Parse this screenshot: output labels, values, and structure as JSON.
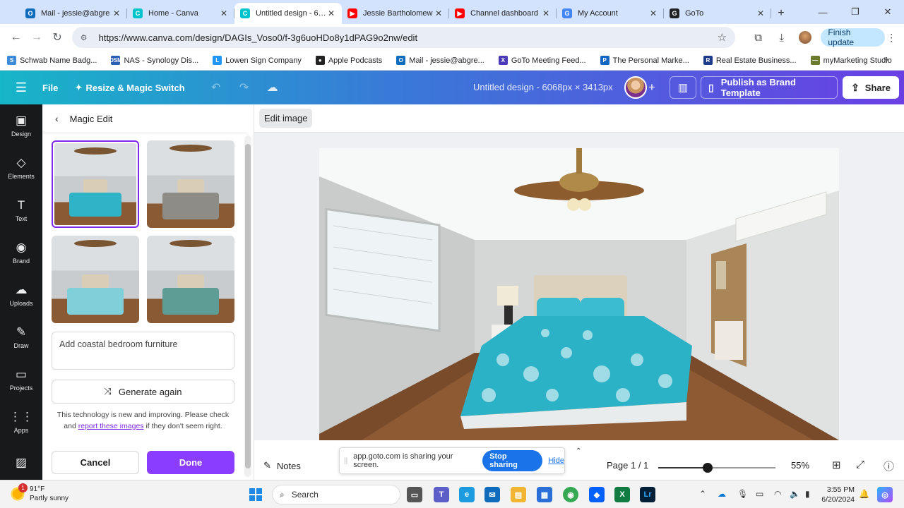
{
  "browser": {
    "tabs": [
      {
        "title": "Mail - jessie@abgre",
        "favicon": "outlook-icon",
        "color": "#0f6cbd",
        "glyph": "O"
      },
      {
        "title": "Home - Canva",
        "favicon": "canva-icon",
        "color": "#00c4cc",
        "glyph": "C"
      },
      {
        "title": "Untitled design - 606",
        "favicon": "canva-icon",
        "color": "#00c4cc",
        "glyph": "C",
        "active": true
      },
      {
        "title": "Jessie Bartholomew",
        "favicon": "youtube-icon",
        "color": "#ff0000",
        "glyph": "▶"
      },
      {
        "title": "Channel dashboard",
        "favicon": "youtube-icon",
        "color": "#ff0000",
        "glyph": "▶"
      },
      {
        "title": "My Account",
        "favicon": "google-icon",
        "color": "#4285f4",
        "glyph": "G"
      },
      {
        "title": "GoTo",
        "favicon": "goto-icon",
        "color": "#202124",
        "glyph": "G"
      }
    ],
    "url": "https://www.canva.com/design/DAGIs_Voso0/f-3g6uoHDo8y1dPAG9o2nw/edit",
    "finish_update": "Finish update",
    "bookmarks": [
      {
        "label": "Schwab Name Badg...",
        "color": "#3d8bd9",
        "glyph": "S"
      },
      {
        "label": "NAS - Synology Dis...",
        "color": "#2b5fb3",
        "glyph": "DSM"
      },
      {
        "label": "Lowen Sign Company",
        "color": "#2196f3",
        "glyph": "L"
      },
      {
        "label": "Apple Podcasts",
        "color": "#222222",
        "glyph": "●"
      },
      {
        "label": "Mail - jessie@abgre...",
        "color": "#0f6cbd",
        "glyph": "O"
      },
      {
        "label": "GoTo Meeting Feed...",
        "color": "#4a3ab8",
        "glyph": "X"
      },
      {
        "label": "The Personal Marke...",
        "color": "#1565c0",
        "glyph": "P"
      },
      {
        "label": "Real Estate Business...",
        "color": "#1e3a8a",
        "glyph": "R"
      },
      {
        "label": "myMarketing Studio",
        "color": "#6b7a2c",
        "glyph": "—"
      }
    ]
  },
  "canva": {
    "file": "File",
    "resize": "Resize & Magic Switch",
    "design_title": "Untitled design - 6068px × 3413px",
    "publish": "Publish as Brand Template",
    "share": "Share",
    "rail": [
      {
        "label": "Design",
        "icon": "design-icon",
        "glyph": "▣"
      },
      {
        "label": "Elements",
        "icon": "elements-icon",
        "glyph": "◇"
      },
      {
        "label": "Text",
        "icon": "text-icon",
        "glyph": "T"
      },
      {
        "label": "Brand",
        "icon": "brand-icon",
        "glyph": "◉"
      },
      {
        "label": "Uploads",
        "icon": "uploads-icon",
        "glyph": "☁"
      },
      {
        "label": "Draw",
        "icon": "draw-icon",
        "glyph": "✎"
      },
      {
        "label": "Projects",
        "icon": "projects-icon",
        "glyph": "▭"
      },
      {
        "label": "Apps",
        "icon": "apps-icon",
        "glyph": "⋮⋮"
      }
    ],
    "panel": {
      "title": "Magic Edit",
      "prompt": "Add coastal bedroom furniture",
      "generate": "Generate again",
      "note_part1": "This technology is new and improving. Please check and",
      "note_link": "report these images",
      "note_part2": "if they don't seem right.",
      "cancel": "Cancel",
      "done": "Done",
      "thumbnails": [
        {
          "bedding": "#2fb3c7",
          "selected": true
        },
        {
          "bedding": "#8d8c86",
          "selected": false
        },
        {
          "bedding": "#7fd0d8",
          "selected": false
        },
        {
          "bedding": "#5e9c96",
          "selected": false
        }
      ]
    },
    "edit_image": "Edit image",
    "notes": "Notes",
    "page": "Page 1 / 1",
    "zoom": "55%",
    "zoom_fraction": 0.42
  },
  "share_bar": {
    "text": "app.goto.com is sharing your screen.",
    "stop": "Stop sharing",
    "hide": "Hide"
  },
  "taskbar": {
    "temp": "91°F",
    "condition": "Partly sunny",
    "badge": "1",
    "search": "Search",
    "time": "3:55 PM",
    "date": "6/20/2024"
  }
}
